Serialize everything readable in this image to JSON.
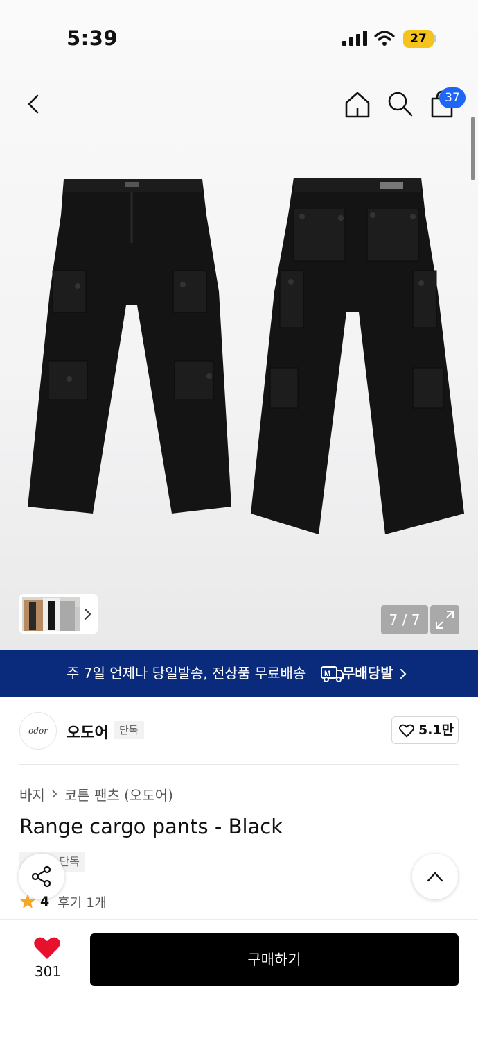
{
  "status_bar": {
    "time": "5:39",
    "battery": "27"
  },
  "nav": {
    "cart_badge": "37"
  },
  "gallery": {
    "page_counter": "7 / 7"
  },
  "promo": {
    "text": "주 7일 언제나 당일발송, 전상품 무료배송",
    "logo_text": "무배당발"
  },
  "brand": {
    "logo_text": "odor",
    "name": "오도어",
    "tag": "단독",
    "like_count": "5.1만"
  },
  "breadcrumb": {
    "category": "바지",
    "subcategory": "코튼 팬츠 (오도어)"
  },
  "product": {
    "title": "Range cargo pants - Black",
    "exclusive_tag": "단독",
    "rating": "4",
    "review_link": "후기 1개"
  },
  "bottom_bar": {
    "likes": "301",
    "buy_label": "구매하기"
  },
  "colors": {
    "promo_bg": "#0a2a7c",
    "badge_blue": "#1e66f5",
    "heart_red": "#e8112d",
    "star_orange": "#f5a623",
    "buy_bg": "#000000"
  }
}
